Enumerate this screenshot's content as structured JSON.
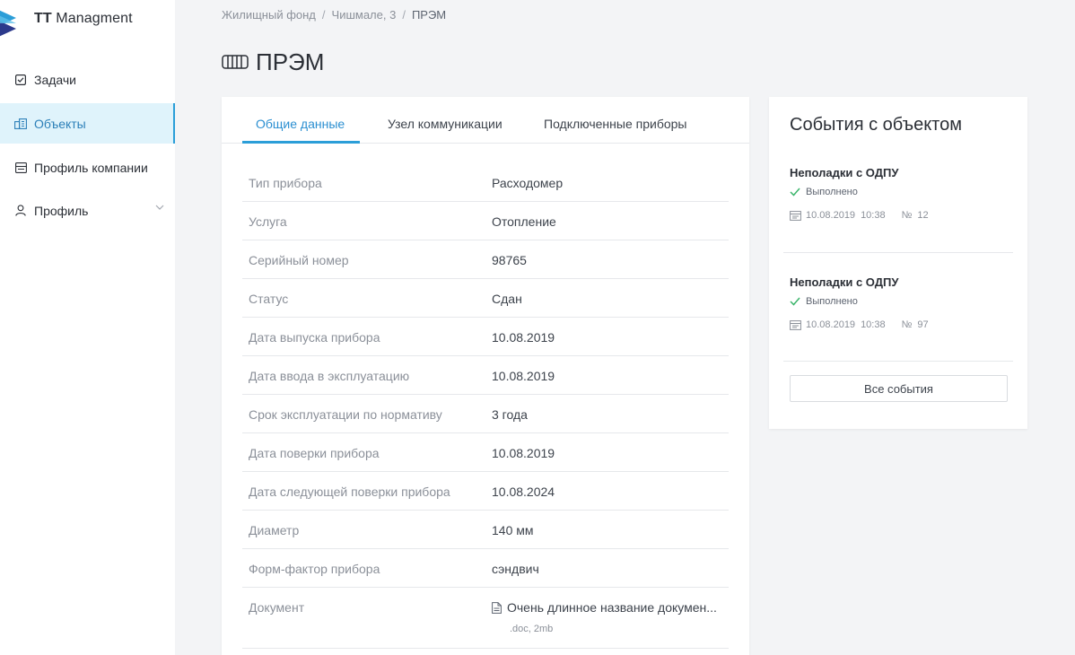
{
  "app": {
    "logo_bold": "TT",
    "logo_rest": " Managment"
  },
  "sidebar": {
    "items": [
      {
        "label": "Задачи",
        "icon": "checkbox-icon"
      },
      {
        "label": "Объекты",
        "icon": "buildings-icon"
      },
      {
        "label": "Профиль компании",
        "icon": "company-icon"
      },
      {
        "label": "Профиль",
        "icon": "user-icon"
      }
    ]
  },
  "breadcrumb": [
    "Жилищный фонд",
    "Чишмале, 3",
    "ПРЭМ"
  ],
  "breadcrumb_sep": "/",
  "page": {
    "title": "ПРЭМ"
  },
  "tabs": [
    "Общие данные",
    "Узел коммуникации",
    "Подключенные приборы"
  ],
  "details": [
    {
      "key": "Тип прибора",
      "value": "Расходомер"
    },
    {
      "key": "Услуга",
      "value": "Отопление"
    },
    {
      "key": "Серийный номер",
      "value": "98765"
    },
    {
      "key": "Статус",
      "value": "Сдан"
    },
    {
      "key": "Дата выпуска прибора",
      "value": "10.08.2019"
    },
    {
      "key": "Дата ввода в эксплуатацию",
      "value": "10.08.2019"
    },
    {
      "key": "Срок эксплуатации по нормативу",
      "value": "3 года"
    },
    {
      "key": "Дата поверки прибора",
      "value": "10.08.2019"
    },
    {
      "key": "Дата следующей поверки прибора",
      "value": "10.08.2024"
    },
    {
      "key": "Диаметр",
      "value": "140 мм"
    },
    {
      "key": "Форм-фактор прибора",
      "value": "сэндвич"
    }
  ],
  "document": {
    "key": "Документ",
    "name": "Очень длинное название докумен...",
    "meta": ".doc, 2mb"
  },
  "events": {
    "title": "События с объектом",
    "items": [
      {
        "name": "Неполадки с ОДПУ",
        "status": "Выполнено",
        "date": "10.08.2019",
        "time": "10:38",
        "num_label": "№",
        "num": "12"
      },
      {
        "name": "Неполадки с ОДПУ",
        "status": "Выполнено",
        "date": "10.08.2019",
        "time": "10:38",
        "num_label": "№",
        "num": "97"
      }
    ],
    "all_button": "Все события"
  },
  "colors": {
    "accent": "#2b9ed8",
    "active_bg": "#dff3fb",
    "success": "#3bb56b"
  }
}
